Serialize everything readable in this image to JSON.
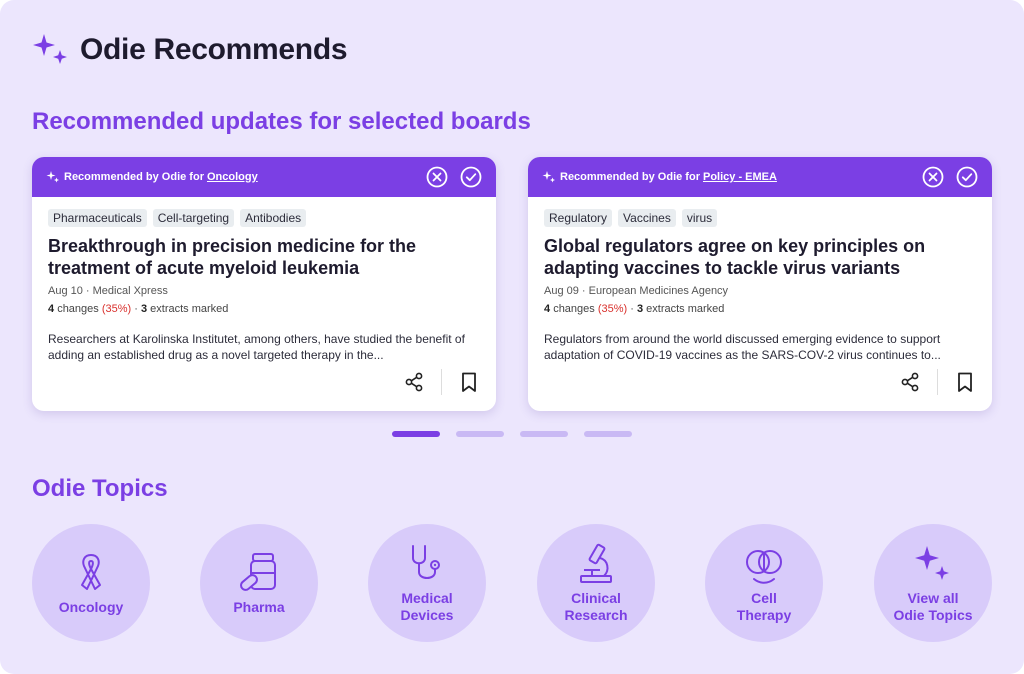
{
  "header": {
    "title": "Odie Recommends",
    "icon": "sparkle-icon"
  },
  "recommended": {
    "section_title": "Recommended updates for selected boards",
    "cards": [
      {
        "prefix": "Recommended by Odie for",
        "board": "Oncology",
        "tags": [
          "Pharmaceuticals",
          "Cell-targeting",
          "Antibodies"
        ],
        "title": "Breakthrough in precision medicine for the treatment of acute myeloid leukemia",
        "date_source": "Aug 10 · Medical Xpress",
        "changes": "4",
        "changes_label": "changes",
        "pct": "(35%)",
        "extracts": "3",
        "extracts_label": "extracts marked",
        "excerpt": "Researchers at Karolinska Institutet, among others, have studied the benefit of adding an established drug as a novel targeted therapy in the..."
      },
      {
        "prefix": "Recommended by Odie for",
        "board": "Policy - EMEA",
        "tags": [
          "Regulatory",
          "Vaccines",
          "virus"
        ],
        "title": "Global regulators agree on key principles on adapting vaccines to tackle virus variants",
        "date_source": "Aug 09 · European Medicines Agency",
        "changes": "4",
        "changes_label": "changes",
        "pct": "(35%)",
        "extracts": "3",
        "extracts_label": "extracts marked",
        "excerpt": "Regulators from around the world discussed emerging evidence to support adaptation of COVID-19 vaccines as the SARS-COV-2 virus continues to..."
      }
    ],
    "pagination": {
      "pages": 4,
      "active": 1
    }
  },
  "topics": {
    "section_title": "Odie Topics",
    "items": [
      {
        "label": "Oncology",
        "icon": "ribbon-icon"
      },
      {
        "label": "Pharma",
        "icon": "pill-bottle-icon"
      },
      {
        "label": "Medical\nDevices",
        "icon": "stethoscope-icon"
      },
      {
        "label": "Clinical\nResearch",
        "icon": "microscope-icon"
      },
      {
        "label": "Cell\nTherapy",
        "icon": "cells-icon"
      },
      {
        "label": "View all\nOdie Topics",
        "icon": "sparkle-icon"
      }
    ]
  },
  "colors": {
    "accent": "#7b3fe4",
    "background": "#ece6fd",
    "topic_circle": "#d8cbfa",
    "pct_red": "#d9302c"
  }
}
